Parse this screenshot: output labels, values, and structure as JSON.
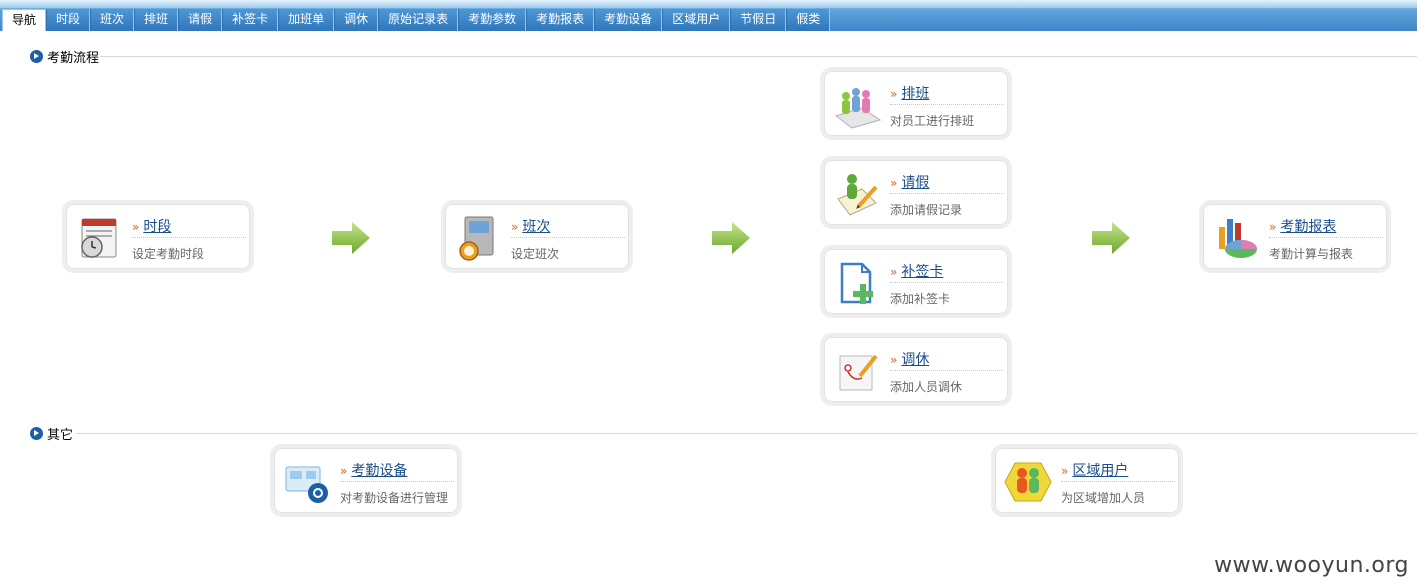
{
  "tabs": [
    "导航",
    "时段",
    "班次",
    "排班",
    "请假",
    "补签卡",
    "加班单",
    "调休",
    "原始记录表",
    "考勤参数",
    "考勤报表",
    "考勤设备",
    "区域用户",
    "节假日",
    "假类"
  ],
  "active_tab": "导航",
  "sections": {
    "process": "考勤流程",
    "other": "其它"
  },
  "cards": {
    "shiduan": {
      "title": "时段",
      "desc": "设定考勤时段",
      "icon": "calendar-clock-icon"
    },
    "banci": {
      "title": "班次",
      "desc": "设定班次",
      "icon": "book-alarm-icon"
    },
    "paiban": {
      "title": "排班",
      "desc": "对员工进行排班",
      "icon": "people-schedule-icon"
    },
    "qingjia": {
      "title": "请假",
      "desc": "添加请假记录",
      "icon": "person-pencil-icon"
    },
    "buqianka": {
      "title": "补签卡",
      "desc": "添加补签卡",
      "icon": "document-add-icon"
    },
    "tiaoxiu": {
      "title": "调休",
      "desc": "添加人员调休",
      "icon": "edit-pencil-icon"
    },
    "baobiao": {
      "title": "考勤报表",
      "desc": "考勤计算与报表",
      "icon": "chart-report-icon"
    },
    "shebei": {
      "title": "考勤设备",
      "desc": "对考勤设备进行管理",
      "icon": "device-settings-icon"
    },
    "quyu": {
      "title": "区域用户",
      "desc": "为区域增加人员",
      "icon": "region-users-icon"
    }
  },
  "watermark": "www.wooyun.org",
  "colors": {
    "tab_bar": "#3f86c8",
    "link": "#1a4e8a",
    "raquo": "#e4631b",
    "arrow": "#8cc63f"
  }
}
